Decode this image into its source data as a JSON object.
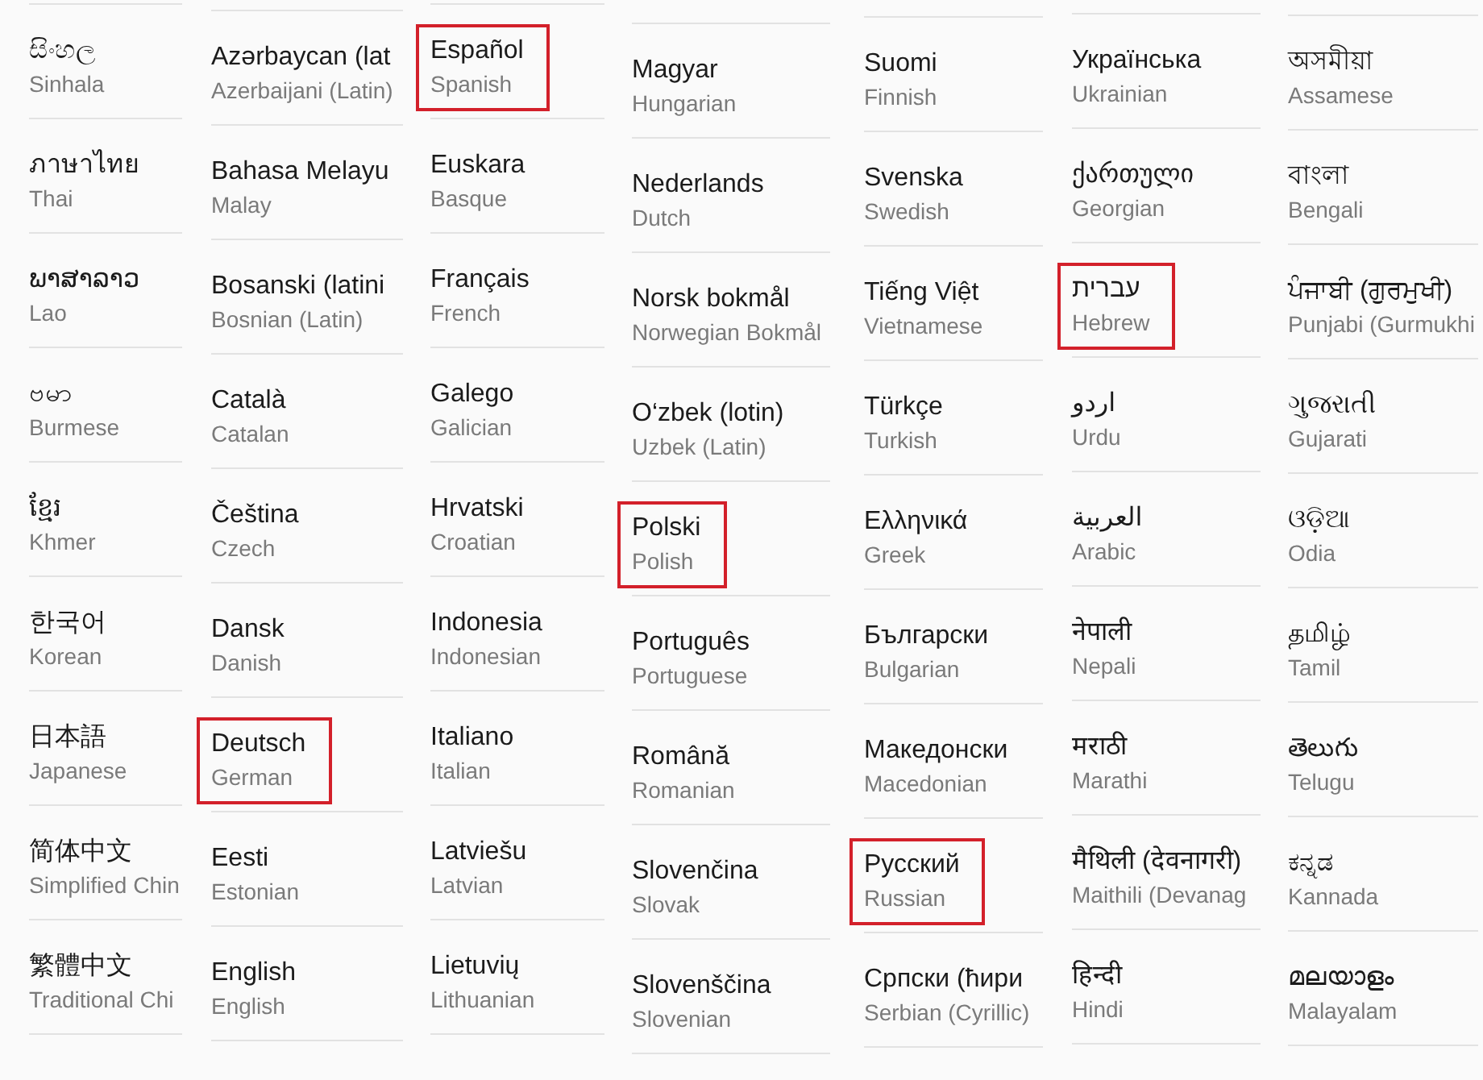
{
  "columns": [
    {
      "items": [
        {
          "native": "සිංහල",
          "english": "Sinhala",
          "highlighted": false
        },
        {
          "native": "ภาษาไทย",
          "english": "Thai",
          "highlighted": false
        },
        {
          "native": "ພາສາລາວ",
          "english": "Lao",
          "highlighted": false
        },
        {
          "native": "ဗမာ",
          "english": "Burmese",
          "highlighted": false
        },
        {
          "native": "ខ្មែរ",
          "english": "Khmer",
          "highlighted": false
        },
        {
          "native": "한국어",
          "english": "Korean",
          "highlighted": false
        },
        {
          "native": "日本語",
          "english": "Japanese",
          "highlighted": false
        },
        {
          "native": "简体中文",
          "english": "Simplified Chin",
          "highlighted": false
        },
        {
          "native": "繁體中文",
          "english": "Traditional Chi",
          "highlighted": false
        }
      ]
    },
    {
      "items": [
        {
          "native": "Azərbaycan (lat",
          "english": "Azerbaijani (Latin)",
          "highlighted": false
        },
        {
          "native": "Bahasa Melayu",
          "english": "Malay",
          "highlighted": false
        },
        {
          "native": "Bosanski (latini",
          "english": "Bosnian (Latin)",
          "highlighted": false
        },
        {
          "native": "Català",
          "english": "Catalan",
          "highlighted": false
        },
        {
          "native": "Čeština",
          "english": "Czech",
          "highlighted": false
        },
        {
          "native": "Dansk",
          "english": "Danish",
          "highlighted": false
        },
        {
          "native": "Deutsch",
          "english": "German",
          "highlighted": true
        },
        {
          "native": "Eesti",
          "english": "Estonian",
          "highlighted": false
        },
        {
          "native": "English",
          "english": "English",
          "highlighted": false
        }
      ]
    },
    {
      "items": [
        {
          "native": "Español",
          "english": "Spanish",
          "highlighted": true
        },
        {
          "native": "Euskara",
          "english": "Basque",
          "highlighted": false
        },
        {
          "native": "Français",
          "english": "French",
          "highlighted": false
        },
        {
          "native": "Galego",
          "english": "Galician",
          "highlighted": false
        },
        {
          "native": "Hrvatski",
          "english": "Croatian",
          "highlighted": false
        },
        {
          "native": "Indonesia",
          "english": "Indonesian",
          "highlighted": false
        },
        {
          "native": "Italiano",
          "english": "Italian",
          "highlighted": false
        },
        {
          "native": "Latviešu",
          "english": "Latvian",
          "highlighted": false
        },
        {
          "native": "Lietuvių",
          "english": "Lithuanian",
          "highlighted": false
        }
      ]
    },
    {
      "items": [
        {
          "native": "Magyar",
          "english": "Hungarian",
          "highlighted": false
        },
        {
          "native": "Nederlands",
          "english": "Dutch",
          "highlighted": false
        },
        {
          "native": "Norsk bokmål",
          "english": "Norwegian Bokmål",
          "highlighted": false
        },
        {
          "native": "O‘zbek (lotin)",
          "english": "Uzbek (Latin)",
          "highlighted": false
        },
        {
          "native": "Polski",
          "english": "Polish",
          "highlighted": true
        },
        {
          "native": "Português",
          "english": "Portuguese",
          "highlighted": false
        },
        {
          "native": "Română",
          "english": "Romanian",
          "highlighted": false
        },
        {
          "native": "Slovenčina",
          "english": "Slovak",
          "highlighted": false
        },
        {
          "native": "Slovenščina",
          "english": "Slovenian",
          "highlighted": false
        }
      ]
    },
    {
      "items": [
        {
          "native": "Suomi",
          "english": "Finnish",
          "highlighted": false
        },
        {
          "native": "Svenska",
          "english": "Swedish",
          "highlighted": false
        },
        {
          "native": "Tiếng Việt",
          "english": "Vietnamese",
          "highlighted": false
        },
        {
          "native": "Türkçe",
          "english": "Turkish",
          "highlighted": false
        },
        {
          "native": "Ελληνικά",
          "english": "Greek",
          "highlighted": false
        },
        {
          "native": "Български",
          "english": "Bulgarian",
          "highlighted": false
        },
        {
          "native": "Македонски",
          "english": "Macedonian",
          "highlighted": false
        },
        {
          "native": "Русский",
          "english": "Russian",
          "highlighted": true
        },
        {
          "native": "Српски (ћири",
          "english": "Serbian (Cyrillic)",
          "highlighted": false
        }
      ]
    },
    {
      "items": [
        {
          "native": "Українська",
          "english": "Ukrainian",
          "highlighted": false
        },
        {
          "native": "ქართული",
          "english": "Georgian",
          "highlighted": false
        },
        {
          "native": "עברית",
          "english": "Hebrew",
          "highlighted": true
        },
        {
          "native": "اردو",
          "english": "Urdu",
          "highlighted": false
        },
        {
          "native": "العربية",
          "english": "Arabic",
          "highlighted": false
        },
        {
          "native": "नेपाली",
          "english": "Nepali",
          "highlighted": false
        },
        {
          "native": "मराठी",
          "english": "Marathi",
          "highlighted": false
        },
        {
          "native": "मैथिली (देवनागरी)",
          "english": "Maithili (Devanag",
          "highlighted": false
        },
        {
          "native": "हिन्दी",
          "english": "Hindi",
          "highlighted": false
        }
      ]
    },
    {
      "items": [
        {
          "native": "অসমীয়া",
          "english": "Assamese",
          "highlighted": false
        },
        {
          "native": "বাংলা",
          "english": "Bengali",
          "highlighted": false
        },
        {
          "native": "ਪੰਜਾਬੀ (ਗੁਰਮੁਖੀ)",
          "english": "Punjabi (Gurmukhi",
          "highlighted": false
        },
        {
          "native": "ગુજરાતી",
          "english": "Gujarati",
          "highlighted": false
        },
        {
          "native": "ଓଡ଼ିଆ",
          "english": "Odia",
          "highlighted": false
        },
        {
          "native": "தமிழ்",
          "english": "Tamil",
          "highlighted": false
        },
        {
          "native": "తెలుగు",
          "english": "Telugu",
          "highlighted": false
        },
        {
          "native": "ಕನ್ನಡ",
          "english": "Kannada",
          "highlighted": false
        },
        {
          "native": "മലയാളം",
          "english": "Malayalam",
          "highlighted": false
        }
      ]
    }
  ]
}
